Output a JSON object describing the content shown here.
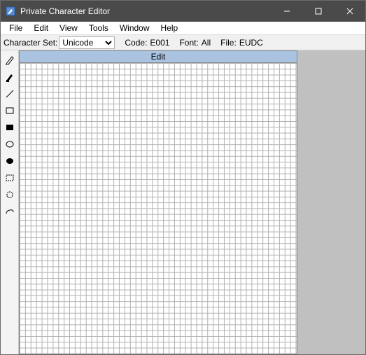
{
  "window": {
    "title": "Private Character Editor"
  },
  "menu": {
    "items": [
      "File",
      "Edit",
      "View",
      "Tools",
      "Window",
      "Help"
    ]
  },
  "infobar": {
    "charset_label": "Character Set:",
    "charset_value": "Unicode",
    "code_label": "Code:",
    "code_value": "E001",
    "font_label": "Font:",
    "font_value": "All",
    "file_label": "File:",
    "file_value": "EUDC"
  },
  "canvas": {
    "header": "Edit"
  },
  "tools": [
    {
      "name": "pencil-tool",
      "icon": "pencil-icon"
    },
    {
      "name": "brush-tool",
      "icon": "brush-icon"
    },
    {
      "name": "line-tool",
      "icon": "line-icon"
    },
    {
      "name": "rect-outline-tool",
      "icon": "rect-outline-icon"
    },
    {
      "name": "rect-fill-tool",
      "icon": "rect-fill-icon"
    },
    {
      "name": "ellipse-outline-tool",
      "icon": "ellipse-outline-icon"
    },
    {
      "name": "ellipse-fill-tool",
      "icon": "ellipse-fill-icon"
    },
    {
      "name": "rect-select-tool",
      "icon": "rect-select-icon"
    },
    {
      "name": "free-select-tool",
      "icon": "free-select-icon"
    },
    {
      "name": "eraser-tool",
      "icon": "eraser-icon"
    }
  ]
}
